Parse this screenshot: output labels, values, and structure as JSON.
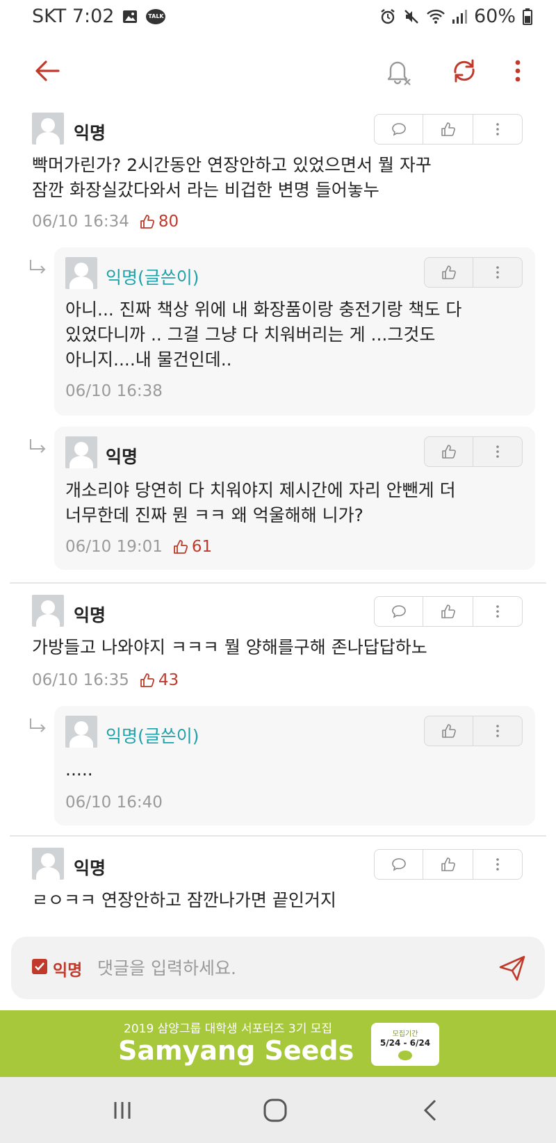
{
  "status_bar": {
    "carrier_time": "SKT 7:02",
    "battery": "60%",
    "icons": [
      "image-icon",
      "kakaotalk-icon",
      "alarm-icon",
      "mute-icon",
      "wifi-icon",
      "signal-icon",
      "battery-icon"
    ],
    "talk_badge": "TALK"
  },
  "header": {
    "back_icon": "back-arrow-icon",
    "notify_icon": "bell-off-icon",
    "refresh_icon": "refresh-icon",
    "more_icon": "more-vertical-icon"
  },
  "colors": {
    "accent": "#c0392b",
    "op_author": "#1ea0a8",
    "banner": "#a6c83a"
  },
  "comments": [
    {
      "author": "익명",
      "text": "빡머가린가? 2시간동안 연장안하고 있었으면서 뭘 자꾸\n잠깐 화장실갔다와서 라는 비겁한 변명 들어놓누",
      "time": "06/10 16:34",
      "likes": "80",
      "replies": [
        {
          "author": "익명(글쓴이)",
          "text": "아니... 진짜 책상 위에 내 화장품이랑 충전기랑 책도 다\n있었다니까 .. 그걸 그냥 다 치워버리는 게 ...그것도\n아니지....내 물건인데..",
          "time": "06/10 16:38"
        },
        {
          "author": "익명",
          "text": "개소리야 당연히 다 치워야지 제시간에 자리 안뺀게 더\n너무한데 진짜 뭔 ㅋㅋ 왜 억울해해 니가?",
          "time": "06/10 19:01",
          "likes": "61"
        }
      ]
    },
    {
      "author": "익명",
      "text": "가방들고 나와야지 ㅋㅋㅋ 뭘 양해를구해 존나답답하노",
      "time": "06/10 16:35",
      "likes": "43",
      "replies": [
        {
          "author": "익명(글쓴이)",
          "text": ".....",
          "time": "06/10 16:40"
        }
      ]
    },
    {
      "author": "익명",
      "text": "ㄹㅇㅋㅋ 연장안하고 잠깐나가면 끝인거지"
    }
  ],
  "input_bar": {
    "anonymous_label": "익명",
    "anonymous_checked": true,
    "placeholder": "댓글을 입력하세요."
  },
  "banner": {
    "subtitle": "2019 삼양그룹 대학생 서포터즈 3기 모집",
    "title": "Samyang Seeds",
    "period_label": "모집기간",
    "period": "5/24 - 6/24"
  },
  "nav_bar": {
    "icons": [
      "recent-apps-icon",
      "home-icon",
      "back-icon"
    ]
  }
}
